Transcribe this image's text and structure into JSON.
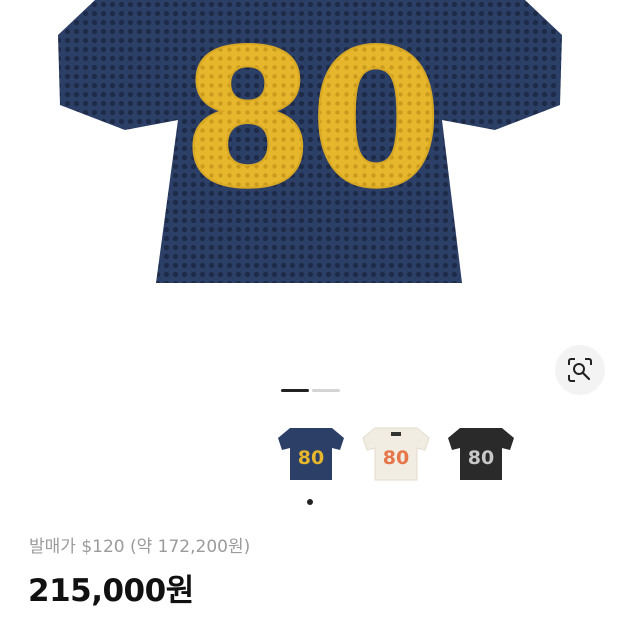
{
  "product": {
    "jersey_number": "80",
    "colors": {
      "navy": "#2c3f67",
      "yellow": "#e6b62c",
      "cream": "#f2ede2",
      "orange": "#e5764a",
      "black": "#2a2a2a",
      "silver": "#c8c8c8"
    }
  },
  "gallery": {
    "current_index": 1,
    "total": 2,
    "lens_icon": "image-search-icon"
  },
  "variants": [
    {
      "number": "80",
      "body": "#2c3f67",
      "digits": "#e6b62c"
    },
    {
      "number": "80",
      "body": "#f2ede2",
      "digits": "#e5764a"
    },
    {
      "number": "80",
      "body": "#2a2a2a",
      "digits": "#c8c8c8"
    }
  ],
  "pricing": {
    "release_price": "발매가 $120 (약 172,200원)",
    "current_price": "215,000원"
  }
}
